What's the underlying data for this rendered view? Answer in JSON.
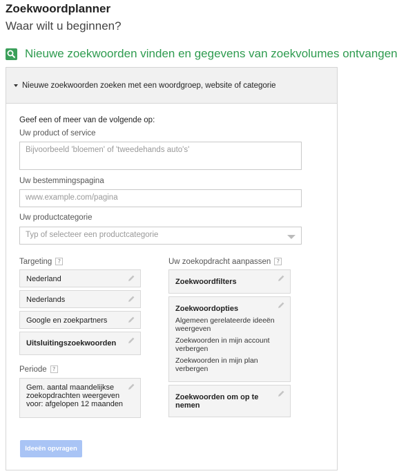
{
  "header": {
    "title": "Zoekwoordplanner",
    "subtitle": "Waar wilt u beginnen?"
  },
  "section": {
    "icon": "search-icon",
    "title": "Nieuwe zoekwoorden vinden en gegevens van zoekvolumes ontvangen",
    "accent_color": "#2e9b4f"
  },
  "panel": {
    "header_label": "Nieuwe zoekwoorden zoeken met een woordgroep, website of categorie",
    "intro": "Geef een of meer van de volgende op:",
    "product_label": "Uw product of service",
    "product_placeholder": "Bijvoorbeeld 'bloemen' of 'tweedehands auto's'",
    "landing_label": "Uw bestemmingspagina",
    "landing_placeholder": "www.example.com/pagina",
    "category_label": "Uw productcategorie",
    "category_placeholder": "Typ of selecteer een productcategorie"
  },
  "targeting": {
    "label": "Targeting",
    "help": "?",
    "items": [
      "Nederland",
      "Nederlands",
      "Google en zoekpartners",
      "Uitsluitingszoekwoorden"
    ]
  },
  "period": {
    "label": "Periode",
    "help": "?",
    "lines": [
      "Gem. aantal maandelijkse",
      "zoekopdrachten weergeven",
      "voor: afgelopen 12 maanden"
    ]
  },
  "customize": {
    "label": "Uw zoekopdracht aanpassen",
    "help": "?",
    "filters": "Zoekwoordfilters",
    "options_title": "Zoekwoordopties",
    "options": [
      [
        "Algemeen gerelateerde ideeën",
        "weergeven"
      ],
      [
        "Zoekwoorden in mijn account",
        "verbergen"
      ],
      [
        "Zoekwoorden in mijn plan",
        "verbergen"
      ]
    ],
    "include": [
      "Zoekwoorden om op te",
      "nemen"
    ]
  },
  "button": {
    "label": "Ideeën opvragen",
    "color": "#a9c4f5"
  }
}
